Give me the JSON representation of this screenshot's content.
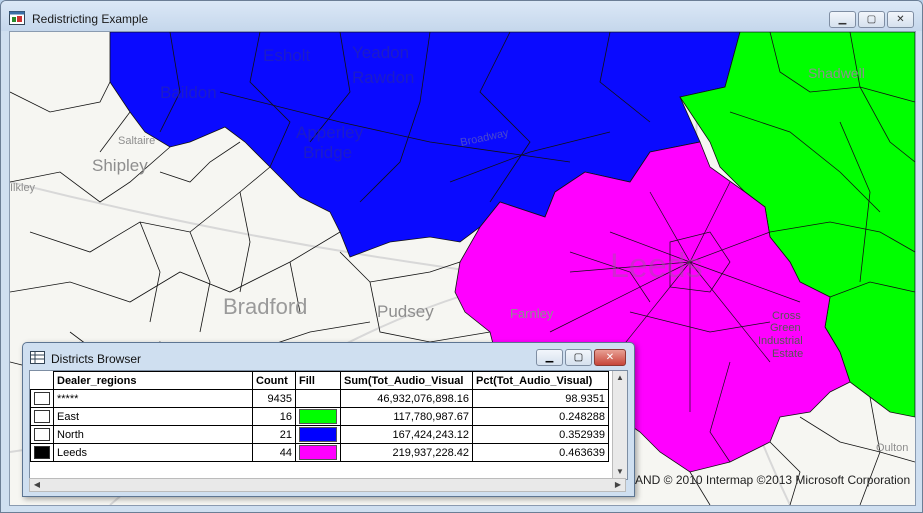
{
  "window": {
    "title": "Redistricting Example",
    "minimize": "▁",
    "maximize": "▢",
    "close": "✕"
  },
  "map": {
    "copyright": "AND © 2010 Intermap ©2013 Microsoft Corporation",
    "labels": [
      "Esholt",
      "Yeadon",
      "Rawdon",
      "Baildon",
      "Apperley",
      "Bridge",
      "Shipley",
      "Saltaire",
      "Bradford",
      "Pudsey",
      "Farnley",
      "Shadwell",
      "Cross",
      "Green",
      "Industrial",
      "Estate",
      "Leeds",
      "Broadway",
      "Ilkley",
      "Oulton"
    ],
    "colors": {
      "north": "#0a0aff",
      "east": "#00ff00",
      "leeds": "#ff00ff",
      "unassigned": "#ffffff"
    }
  },
  "browser": {
    "title": "Districts Browser",
    "columns": [
      "Dealer_regions",
      "Count",
      "Fill",
      "Sum(Tot_Audio_Visual",
      "Pct(Tot_Audio_Visual)"
    ],
    "rows": [
      {
        "name": "*****",
        "count": "9435",
        "fill": "",
        "sum": "46,932,076,898.16",
        "pct": "98.9351",
        "selected": false
      },
      {
        "name": "East",
        "count": "16",
        "fill": "#00ff00",
        "sum": "117,780,987.67",
        "pct": "0.248288",
        "selected": false
      },
      {
        "name": "North",
        "count": "21",
        "fill": "#0000ff",
        "sum": "167,424,243.12",
        "pct": "0.352939",
        "selected": false
      },
      {
        "name": "Leeds",
        "count": "44",
        "fill": "#ff00ff",
        "sum": "219,937,228.42",
        "pct": "0.463639",
        "selected": true
      }
    ]
  }
}
